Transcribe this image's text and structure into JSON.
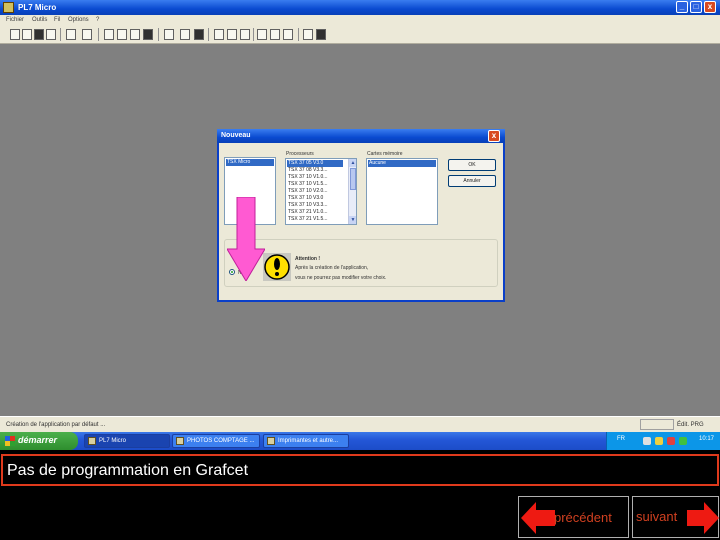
{
  "window": {
    "title": "PL7 Micro",
    "controls": {
      "minimize": "_",
      "maximize": "□",
      "close": "x"
    }
  },
  "menu": [
    "Fichier",
    "Outils",
    "Fil",
    "Options",
    "?"
  ],
  "dialog": {
    "title": "Nouveau",
    "close": "x",
    "processors_label": "Processeurs",
    "memory_label": "Cartes mémoire",
    "family_list": [
      {
        "label": "TSX Micro",
        "selected": true
      }
    ],
    "processors": [
      {
        "label": "TSX 37 05   V3.0",
        "selected": true
      },
      {
        "label": "TSX 37 08   V3.3..."
      },
      {
        "label": "TSX 37 10   V1.0..."
      },
      {
        "label": "TSX 37 10   V1.5..."
      },
      {
        "label": "TSX 37 10   V2.0..."
      },
      {
        "label": "TSX 37 10   V3.0"
      },
      {
        "label": "TSX 37 10   V3.3..."
      },
      {
        "label": "TSX 37 21   V1.0..."
      },
      {
        "label": "TSX 37 21   V1.5..."
      }
    ],
    "memory_cards": [
      {
        "label": "Aucune",
        "selected": true
      }
    ],
    "ok_label": "OK",
    "cancel_label": "Annuler",
    "radio_label": "Non",
    "warning": {
      "title": "Attention !",
      "line1": "Après la création de l'application,",
      "line2": "vous ne pourrez pas modifier votre choix."
    }
  },
  "status": {
    "left": "Création de l'application par défaut ...",
    "right": "Édit. PRG"
  },
  "taskbar": {
    "start_label": "démarrer",
    "items": [
      {
        "label": "PL7 Micro",
        "active": true
      },
      {
        "label": "PHOTOS COMPTAGE ..."
      },
      {
        "label": "Imprimantes et autre..."
      }
    ],
    "lang": "FR",
    "clock": "10:17"
  },
  "caption": "Pas de programmation en Grafcet",
  "nav": {
    "previous_label": "précédent",
    "next_label": "suivant"
  },
  "colors": {
    "accent_red": "#e03a1c",
    "arrow_pink": "#ff5ad2",
    "xp_blue": "#0a4ad0"
  },
  "icons": [
    "app-icon",
    "warning-icon",
    "windows-flag-icon",
    "previous-arrow-icon",
    "next-arrow-icon"
  ]
}
